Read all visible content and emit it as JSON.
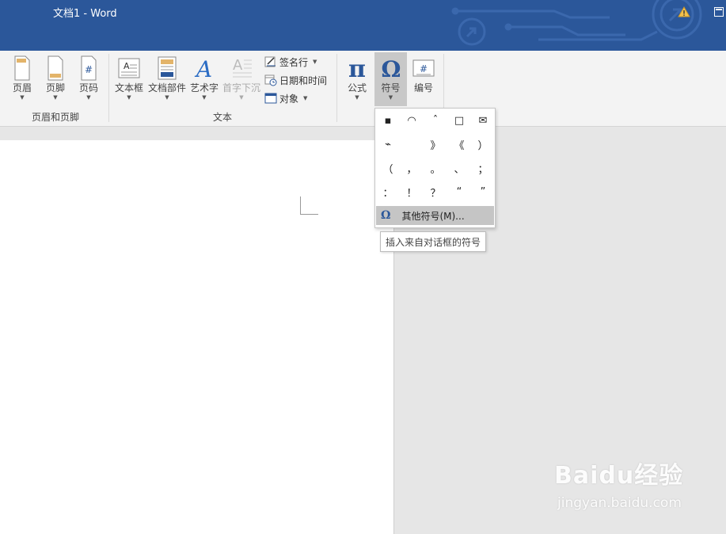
{
  "window": {
    "title": "文档1  -  Word"
  },
  "ribbon": {
    "groups": [
      {
        "label": "页眉和页脚",
        "buttons": [
          "页眉",
          "页脚",
          "页码"
        ]
      },
      {
        "label": "文本",
        "buttons": [
          "文本框",
          "文档部件",
          "艺术字",
          "首字下沉"
        ],
        "small_buttons": [
          "签名行",
          "日期和时间",
          "对象"
        ]
      }
    ],
    "symbols_group": {
      "equation": "公式",
      "symbol": "符号",
      "number": "编号"
    }
  },
  "symbol_dropdown": {
    "symbols": [
      "▪",
      "◠",
      "ˆ",
      "□",
      "✉",
      "⌁",
      "",
      "》",
      "《",
      "）",
      "（",
      "，",
      "。",
      "、",
      "；",
      "：",
      "！",
      "？",
      "“",
      "”"
    ],
    "more_symbols_label": "其他符号(M)...",
    "tooltip": "插入来自对话框的符号"
  },
  "watermark": {
    "brand": "Baidu经验",
    "url": "jingyan.baidu.com"
  },
  "colors": {
    "title_bar": "#2b579a",
    "accent": "#2b579a"
  }
}
